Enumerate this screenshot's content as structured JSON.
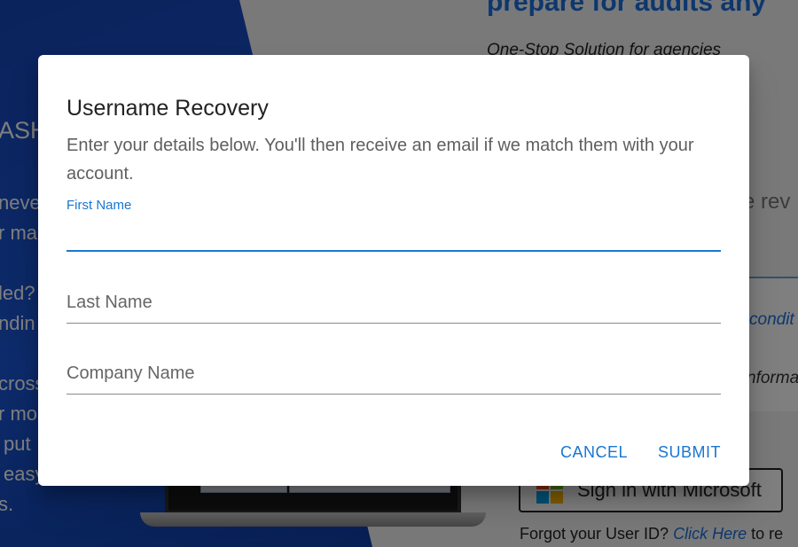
{
  "background": {
    "headline": "prepare for audits any",
    "tagline": "One-Stop Solution for agencies",
    "left_fragments": [
      "ASH",
      "neve",
      "r ma",
      "led?",
      "ndin",
      "cross",
      "r mor",
      "put",
      "easy",
      "s."
    ],
    "right_fragment_rev": "e rev",
    "link_condit": "condit",
    "text_informa": "nforma",
    "microsoft_button_label": "Sign in with Microsoft",
    "forgot_prefix": "Forgot your User ID?",
    "forgot_link": "Click Here",
    "forgot_suffix": "to re"
  },
  "dialog": {
    "title": "Username Recovery",
    "description": "Enter your details below. You'll then receive an email if we match them with your account.",
    "fields": {
      "first_name": {
        "label": "First Name",
        "value": ""
      },
      "last_name": {
        "label": "Last Name",
        "value": ""
      },
      "company_name": {
        "label": "Company Name",
        "value": ""
      }
    },
    "actions": {
      "cancel": "CANCEL",
      "submit": "SUBMIT"
    }
  },
  "colors": {
    "accent": "#1976d2",
    "overlay": "rgba(0,0,0,0.5)",
    "background_blue": "#1a56d6"
  }
}
